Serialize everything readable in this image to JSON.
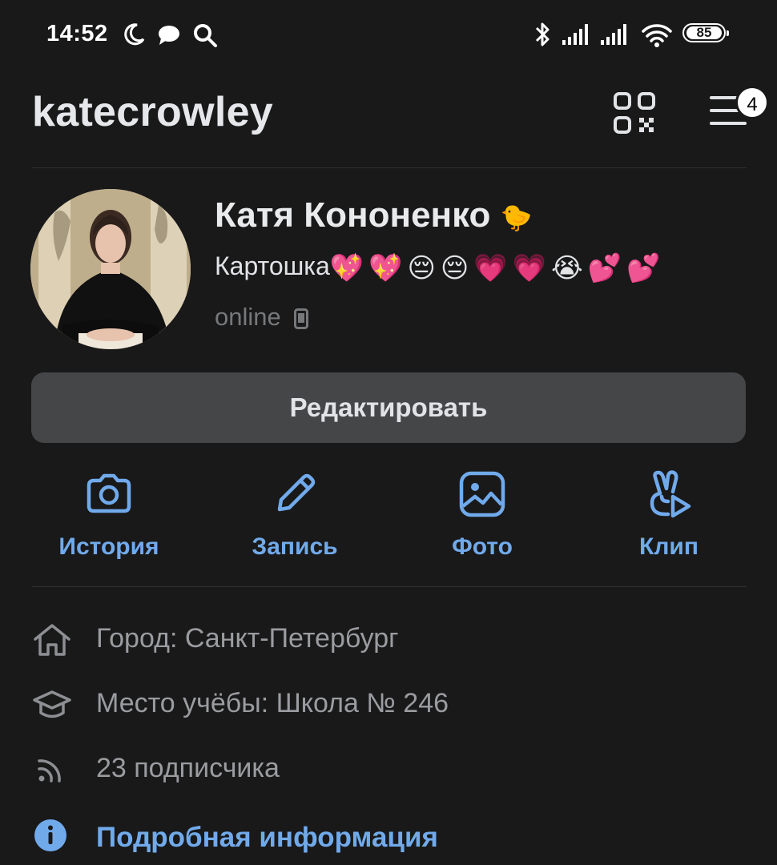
{
  "status_bar": {
    "time": "14:52",
    "battery": "85",
    "icons": [
      "moon-icon",
      "chat-bubble-icon",
      "search-icon",
      "bluetooth-icon",
      "signal-icon",
      "signal-icon",
      "wifi-icon",
      "battery-icon"
    ]
  },
  "header": {
    "username": "katecrowley",
    "menu_badge": "4",
    "icons": [
      "qr-code-icon",
      "menu-icon"
    ]
  },
  "profile": {
    "name": "Катя Кононенко",
    "name_emoji": "🐤",
    "status_text": "Картошка",
    "status_emojis": "💖💖😔😔💗💗😭💕💕",
    "online": "online"
  },
  "edit_button": "Редактировать",
  "actions": [
    {
      "label": "История",
      "icon": "camera-icon"
    },
    {
      "label": "Запись",
      "icon": "pencil-icon"
    },
    {
      "label": "Фото",
      "icon": "photo-icon"
    },
    {
      "label": "Клип",
      "icon": "clip-icon"
    }
  ],
  "info": [
    {
      "text": "Город: Санкт-Петербург",
      "icon": "home-icon"
    },
    {
      "text": "Место учёбы: Школа № 246",
      "icon": "graduation-cap-icon"
    },
    {
      "text": "23 подписчика",
      "icon": "rss-icon"
    },
    {
      "text": "Подробная информация",
      "icon": "info-icon"
    }
  ],
  "colors": {
    "background": "#19191a",
    "accent": "#71aaeb",
    "button": "#454647",
    "secondary_text": "#9a9ca0"
  }
}
